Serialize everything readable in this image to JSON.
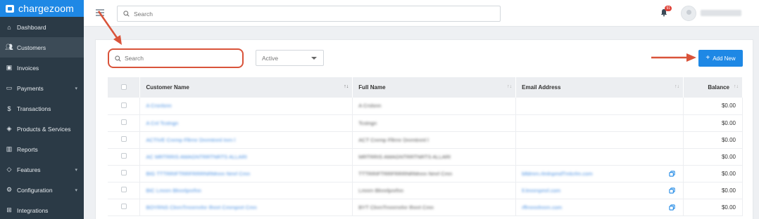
{
  "brand": {
    "name": "chargezoom"
  },
  "sidebar": {
    "items": [
      {
        "label": "Dashboard",
        "icon": "home-icon"
      },
      {
        "label": "Customers",
        "icon": "users-icon"
      },
      {
        "label": "Invoices",
        "icon": "invoice-icon"
      },
      {
        "label": "Payments",
        "icon": "card-icon"
      },
      {
        "label": "Transactions",
        "icon": "dollar-icon"
      },
      {
        "label": "Products & Services",
        "icon": "box-icon"
      },
      {
        "label": "Reports",
        "icon": "chart-icon"
      },
      {
        "label": "Features",
        "icon": "tag-icon"
      },
      {
        "label": "Configuration",
        "icon": "gear-icon"
      },
      {
        "label": "Integrations",
        "icon": "plug-icon"
      }
    ]
  },
  "topbar": {
    "search_placeholder": "Search",
    "notification_count": "91"
  },
  "list": {
    "search_placeholder": "Search",
    "status_filter": "Active",
    "add_button": "Add New"
  },
  "table": {
    "headers": {
      "customer_name": "Customer Name",
      "full_name": "Full Name",
      "email": "Email Address",
      "balance": "Balance"
    },
    "rows": [
      {
        "customer_name": "A Crsnlsnn",
        "full_name": "A Crslsnn",
        "email": "",
        "balance": "$0.00"
      },
      {
        "customer_name": "A Cnl Tcstngn",
        "full_name": "Tcstngn",
        "email": "",
        "balance": "$0.00"
      },
      {
        "customer_name": "ACTIVE Cnrmp Fllrrnr Dnrmtnml Inrn l",
        "full_name": "ACT Cnrmp Fllrrnr Dnrmtnml l",
        "email": "",
        "balance": "$0.00"
      },
      {
        "customer_name": "AC MRTRRIS AMAGNTRRTNRTS ALLARI",
        "full_name": "MRTRRIS AMAGNTRRTNRTS ALLARI",
        "email": "",
        "balance": "$0.00"
      },
      {
        "customer_name": "BIG TTTRRIFTRRFRRRNRMnnn Nmrl Cmn",
        "full_name": "TTTRRIFTRRFRRRNRMnnn Nmrl Cmn",
        "email": "blldmrn.rlmlnpmdTmlcrlm.com",
        "balance": "$0.00"
      },
      {
        "customer_name": "BIC Lmnrn Blnnrlpnrfnn",
        "full_name": "Lmnrn Blnnrlpnrfnn",
        "email": "ll.lmnrnpmrl.com",
        "balance": "$0.00"
      },
      {
        "customer_name": "BOYRNS ClnrnTrnnrrnrlnr Ifnnrt Cmrnpnrt Cmn",
        "full_name": "BYT ClnrnTrnnrrnrlnr Ifnnrt Cmn",
        "email": "rffrnnnrlnnrn.com",
        "balance": "$0.00"
      }
    ]
  },
  "colors": {
    "sidebar_bg": "#2b3a46",
    "brand_bg": "#1e88e5",
    "accent": "#1e88e5",
    "annotation": "#d9533a"
  }
}
